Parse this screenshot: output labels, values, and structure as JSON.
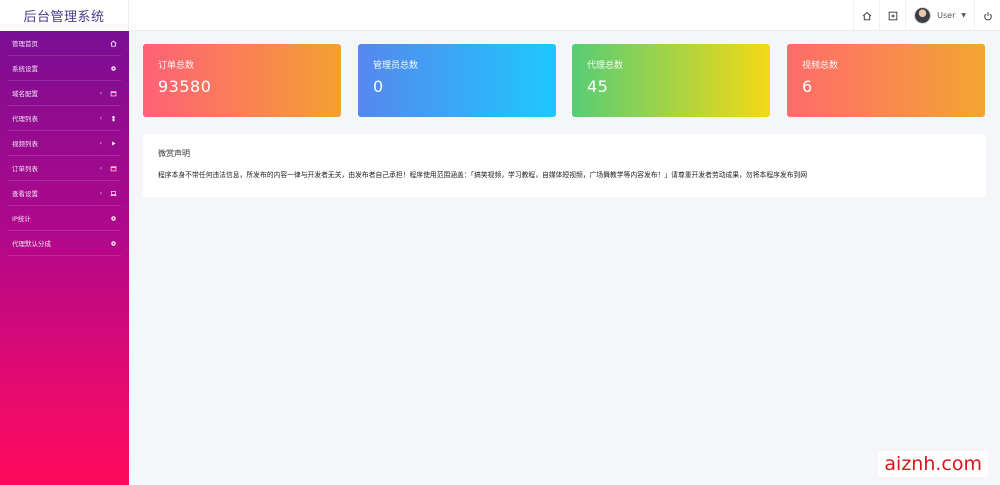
{
  "app": {
    "title": "后台管理系统"
  },
  "header": {
    "user_name": "User",
    "home_icon": "home-icon",
    "fullscreen_icon": "expand-icon",
    "power_icon": "power-icon"
  },
  "sidebar": {
    "items": [
      {
        "label": "管理首页",
        "icon": "home-icon",
        "has_children": false
      },
      {
        "label": "系统设置",
        "icon": "gear-icon",
        "has_children": false
      },
      {
        "label": "域名配置",
        "icon": "calendar-icon",
        "has_children": true
      },
      {
        "label": "代理列表",
        "icon": "user-icon",
        "has_children": true
      },
      {
        "label": "视频列表",
        "icon": "play-icon",
        "has_children": true
      },
      {
        "label": "订单列表",
        "icon": "calendar-icon",
        "has_children": true
      },
      {
        "label": "查看设置",
        "icon": "laptop-icon",
        "has_children": true
      },
      {
        "label": "IP统计",
        "icon": "gear-icon",
        "has_children": false
      },
      {
        "label": "代理默认分成",
        "icon": "gear-icon",
        "has_children": false
      }
    ]
  },
  "stats": [
    {
      "label": "订单总数",
      "value": "93580"
    },
    {
      "label": "管理员总数",
      "value": "0"
    },
    {
      "label": "代理总数",
      "value": "45"
    },
    {
      "label": "视频总数",
      "value": "6"
    }
  ],
  "notice": {
    "title": "微赏声明",
    "text": "程序本身不带任何违法信息，所发布的内容一律与开发者无关，由发布者自己承担！程序使用范围涵盖：「搞笑视频，学习教程，自媒体短视频，广场舞教学等内容发布！」请尊重开发者劳动成果，勿将本程序发布到网"
  },
  "watermark": "aiznh.com",
  "colors": {
    "brand_text": "#4b3a8f",
    "sidebar_top": "#7a0e93",
    "sidebar_bottom": "#ff0a5b",
    "background": "#f4f6f9"
  }
}
